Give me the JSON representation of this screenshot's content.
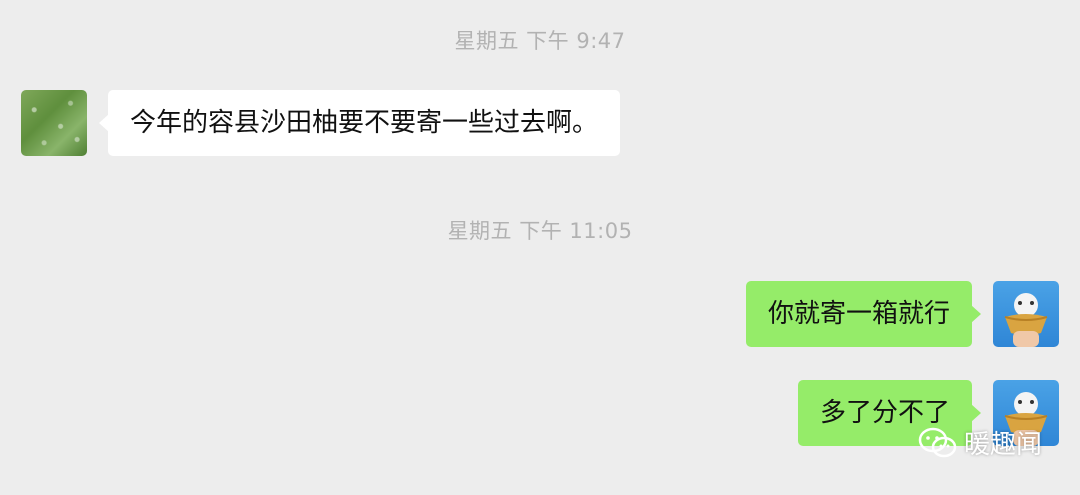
{
  "timestamps": [
    "星期五 下午 9:47",
    "星期五 下午 11:05"
  ],
  "messages": [
    {
      "side": "left",
      "text": "今年的容县沙田柚要不要寄一些过去啊。"
    },
    {
      "side": "right",
      "text": "你就寄一箱就行"
    },
    {
      "side": "right",
      "text": "多了分不了"
    }
  ],
  "watermark": {
    "text": "暖趣闻",
    "icon": "wechat-icon"
  },
  "colors": {
    "background": "#ededed",
    "incoming_bubble": "#ffffff",
    "outgoing_bubble": "#95ec69",
    "timestamp": "#b2b2b2"
  }
}
